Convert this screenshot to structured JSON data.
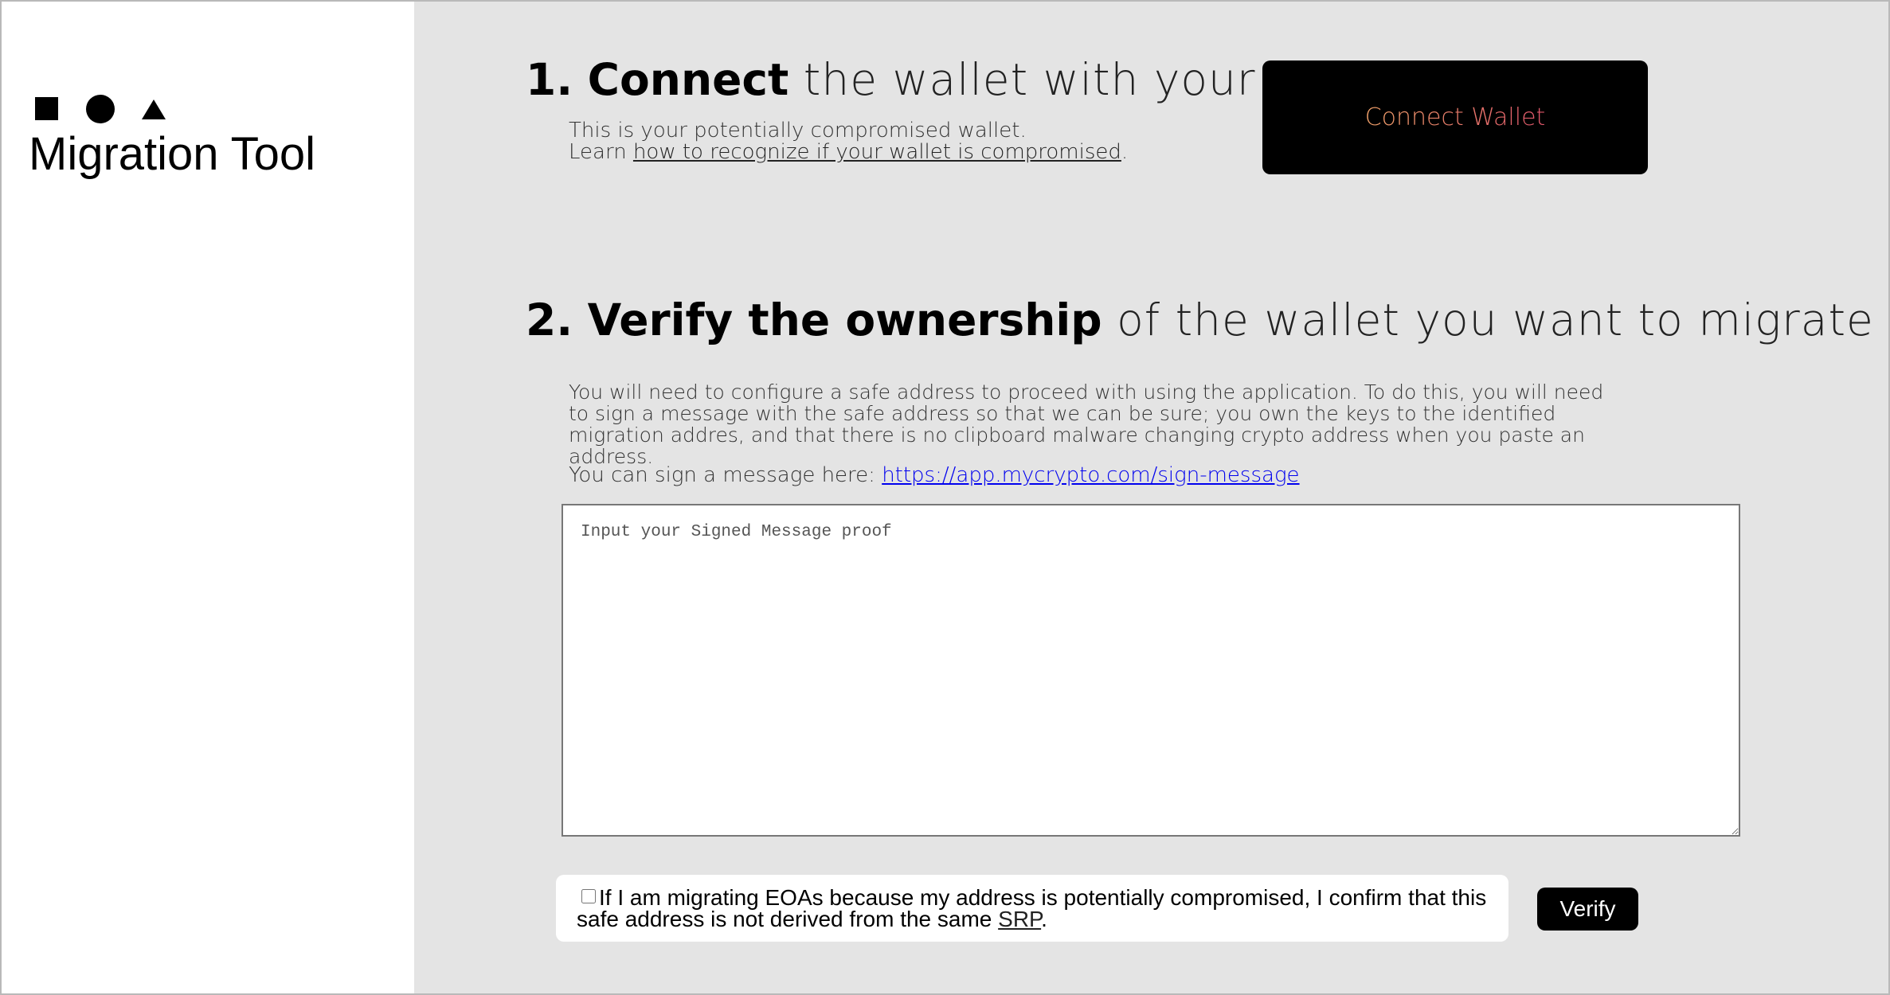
{
  "app": {
    "title": "Migration Tool",
    "logo_icons": [
      "square-icon",
      "circle-icon",
      "triangle-icon"
    ]
  },
  "step1": {
    "number": "1.",
    "bold": "Connect",
    "rest": "the wallet with your assets",
    "desc_line1": "This is your potentially compromised wallet.",
    "desc_learn": "Learn",
    "desc_link": "how to recognize if your wallet is compromised",
    "desc_period": ".",
    "connect_button": "Connect Wallet"
  },
  "step2": {
    "number": "2.",
    "bold": "Verify the ownership",
    "rest": "of the wallet you want to migrate to",
    "description": "You will need to configure a safe address to proceed with using the application. To do this, you will need to sign a message with the safe address so that we can be sure; you own the keys to the identified migration addres, and that there is no clipboard malware changing crypto address when you paste an address.",
    "sign_prefix": "You can sign a message here:",
    "sign_link": "https://app.mycrypto.com/sign-message",
    "proof_placeholder": "Input your Signed Message proof",
    "proof_value": "",
    "confirm_text": "If I am migrating EOAs because my address is potentially compromised, I confirm that this safe address is not derived from the same",
    "confirm_link": "SRP",
    "confirm_period": ".",
    "confirm_checked": false,
    "verify_button": "Verify"
  },
  "colors": {
    "sidebar_bg": "#ffffff",
    "main_bg": "#e4e4e4",
    "button_bg": "#000000",
    "connect_gradient_start": "#f0a16a",
    "connect_gradient_end": "#e0566a"
  }
}
